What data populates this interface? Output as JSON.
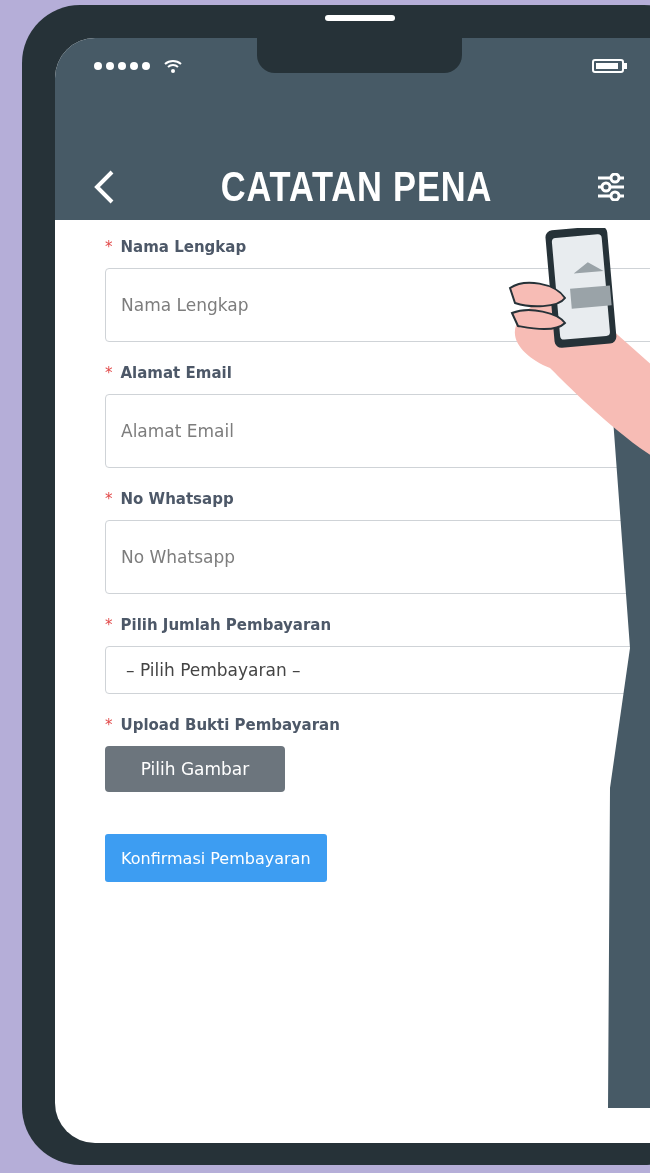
{
  "header": {
    "title": "CATATAN PENA"
  },
  "form": {
    "fields": [
      {
        "kind": "input",
        "label": "Nama Lengkap",
        "required_mark": "*",
        "placeholder": "Nama Lengkap"
      },
      {
        "kind": "input",
        "label": "Alamat Email",
        "required_mark": "*",
        "placeholder": "Alamat Email"
      },
      {
        "kind": "input",
        "label": "No Whatsapp",
        "required_mark": "*",
        "placeholder": "No Whatsapp"
      },
      {
        "kind": "select",
        "label": "Pilih Jumlah Pembayaran",
        "required_mark": "*",
        "value": "– Pilih Pembayaran –"
      },
      {
        "kind": "file",
        "label": "Upload Bukti Pembayaran",
        "required_mark": "*",
        "button": "Pilih Gambar"
      }
    ],
    "submit": "Konfirmasi Pembayaran"
  }
}
